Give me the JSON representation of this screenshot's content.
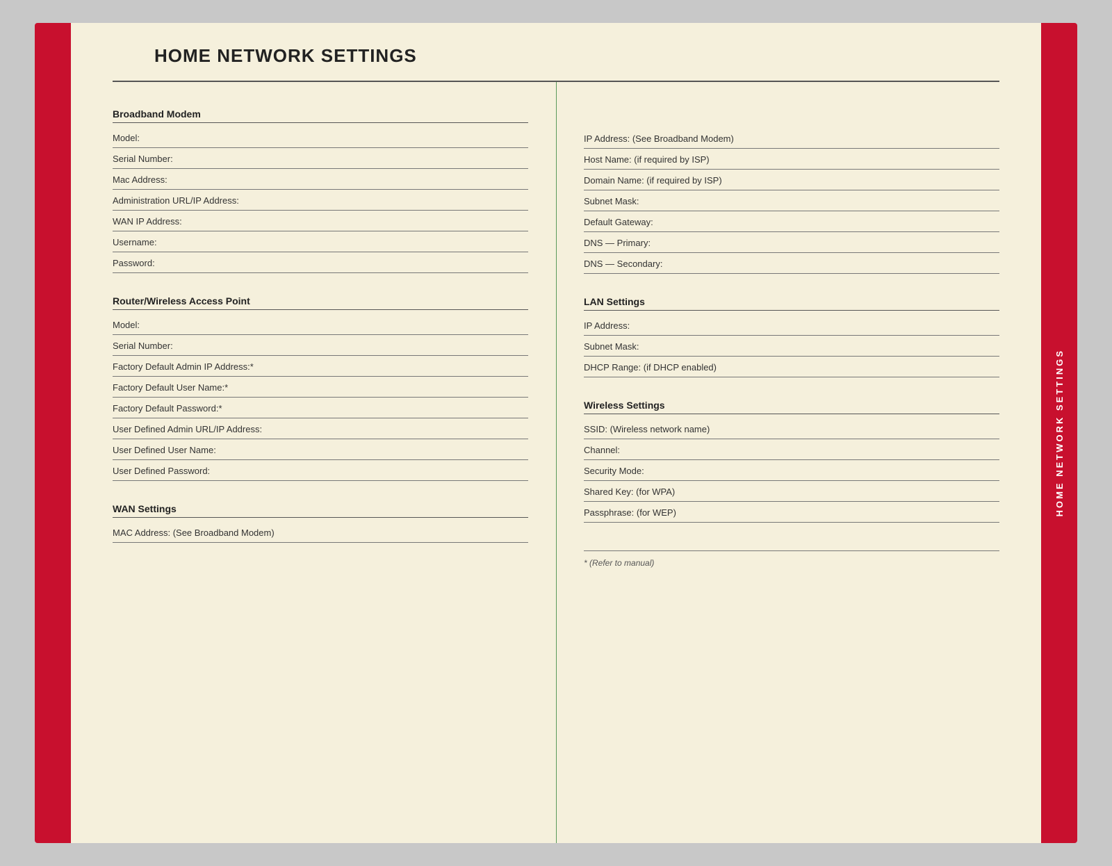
{
  "page": {
    "title": "HOME NETWORK SETTINGS",
    "sidebar_label": "HOME NETWORK SETTINGS"
  },
  "left_column": {
    "sections": [
      {
        "heading": "Broadband Modem",
        "fields": [
          "Model:",
          "Serial Number:",
          "Mac Address:",
          "Administration URL/IP Address:",
          "WAN IP Address:",
          "Username:",
          "Password:"
        ]
      },
      {
        "heading": "Router/Wireless Access Point",
        "fields": [
          "Model:",
          "Serial Number:",
          "Factory Default Admin IP Address:*",
          "Factory Default User Name:*",
          "Factory Default Password:*",
          "User Defined Admin URL/IP Address:",
          "User Defined User Name:",
          "User Defined Password:"
        ]
      },
      {
        "heading": "WAN Settings",
        "fields": [
          "MAC Address: (See Broadband Modem)"
        ]
      }
    ]
  },
  "right_column": {
    "sections": [
      {
        "heading": null,
        "fields": [
          "IP Address: (See Broadband Modem)",
          "Host Name: (if required by ISP)",
          "Domain Name: (if required by ISP)",
          "Subnet Mask:",
          "Default Gateway:",
          "DNS — Primary:",
          "DNS — Secondary:"
        ]
      },
      {
        "heading": "LAN Settings",
        "fields": [
          "IP Address:",
          "Subnet Mask:",
          "DHCP Range: (if DHCP enabled)"
        ]
      },
      {
        "heading": "Wireless Settings",
        "fields": [
          "SSID: (Wireless network name)",
          "Channel:",
          "Security Mode:",
          "Shared Key: (for WPA)",
          "Passphrase: (for WEP)"
        ]
      }
    ],
    "footnote": "* (Refer to manual)"
  }
}
